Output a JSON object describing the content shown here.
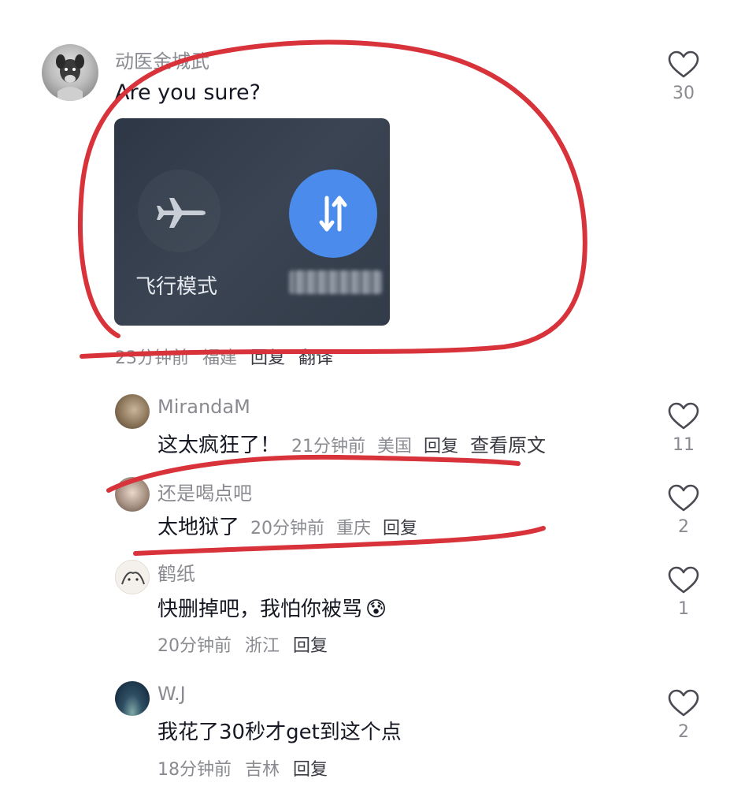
{
  "comments": [
    {
      "username": "动医金城武",
      "text": "Are you sure?",
      "image": {
        "tile_left_label": "飞行模式",
        "tile_right_label": ""
      },
      "time": "23分钟前",
      "location": "福建",
      "reply": "回复",
      "translate": "翻译",
      "likes": "30"
    },
    {
      "username": "MirandaM",
      "text": "这太疯狂了！",
      "time": "21分钟前",
      "location": "美国",
      "reply": "回复",
      "view_original": "查看原文",
      "likes": "11"
    },
    {
      "username": "还是喝点吧",
      "text": "太地狱了",
      "time": "20分钟前",
      "location": "重庆",
      "reply": "回复",
      "likes": "2"
    },
    {
      "username": "鹤纸",
      "text": "快删掉吧，我怕你被骂",
      "emoji": "😰",
      "time": "20分钟前",
      "location": "浙江",
      "reply": "回复",
      "likes": "1"
    },
    {
      "username": "W.J",
      "text": "我花了30秒才get到这个点",
      "time": "18分钟前",
      "location": "吉林",
      "reply": "回复",
      "likes": "2"
    }
  ],
  "icons": {
    "like": "heart-outline-icon",
    "airplane": "airplane-icon",
    "data": "mobile-data-arrows-icon"
  },
  "colors": {
    "accent_blue": "#4a8bec",
    "annotation_red": "#d8323a",
    "muted_text": "#8a8b91"
  }
}
